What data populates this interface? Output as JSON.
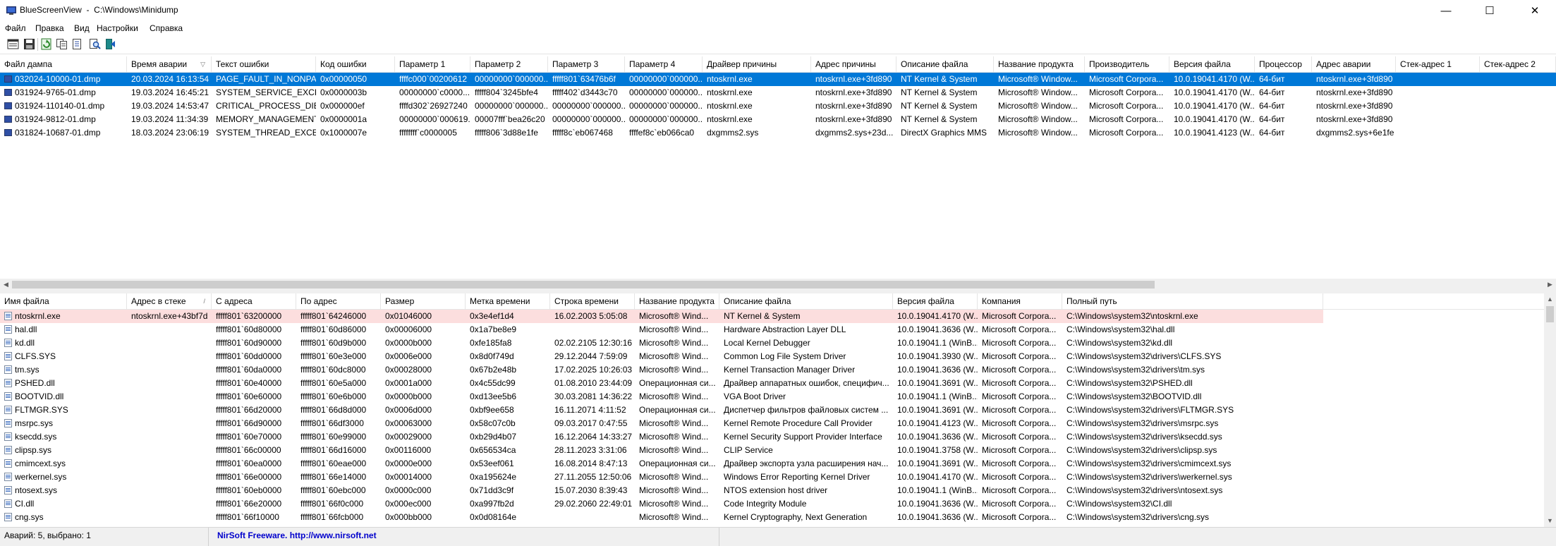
{
  "window": {
    "title": "BlueScreenView  -  C:\\Windows\\Minidump",
    "controls": {
      "minimize": "—",
      "maximize": "☐",
      "close": "✕"
    }
  },
  "menu": [
    "Файл",
    "Правка",
    "Вид",
    "Настройки",
    "Справка"
  ],
  "toolbar": {
    "buttons": [
      "properties-icon",
      "save-icon",
      "refresh-icon",
      "copy-icon",
      "html-report-icon",
      "find-icon",
      "exit-icon"
    ]
  },
  "colors": {
    "selection": "#0078d7",
    "highlight_row": "#fcdede",
    "link": "#0000cc"
  },
  "crash_list": {
    "columns": [
      "Файл дампа",
      "Время аварии",
      "Текст ошибки",
      "Код ошибки",
      "Параметр 1",
      "Параметр 2",
      "Параметр 3",
      "Параметр 4",
      "Драйвер причины",
      "Адрес причины",
      "Описание файла",
      "Название продукта",
      "Производитель",
      "Версия файла",
      "Процессор",
      "Адрес аварии",
      "Стек-адрес 1",
      "Стек-адрес 2"
    ],
    "sort_indicator": "▽",
    "rows": [
      [
        "032024-10000-01.dmp",
        "20.03.2024 16:13:54",
        "PAGE_FAULT_IN_NONPA...",
        "0x00000050",
        "ffffc000`00200612",
        "00000000`000000...",
        "fffff801`63476b6f",
        "00000000`000000...",
        "ntoskrnl.exe",
        "ntoskrnl.exe+3fd890",
        "NT Kernel & System",
        "Microsoft® Window...",
        "Microsoft Corpora...",
        "10.0.19041.4170 (W...",
        "64-бит",
        "ntoskrnl.exe+3fd890",
        "",
        ""
      ],
      [
        "031924-9765-01.dmp",
        "19.03.2024 16:45:21",
        "SYSTEM_SERVICE_EXCEP...",
        "0x0000003b",
        "00000000`c0000...",
        "fffff804`3245bfe4",
        "fffff402`d3443c70",
        "00000000`000000...",
        "ntoskrnl.exe",
        "ntoskrnl.exe+3fd890",
        "NT Kernel & System",
        "Microsoft® Window...",
        "Microsoft Corpora...",
        "10.0.19041.4170 (W...",
        "64-бит",
        "ntoskrnl.exe+3fd890",
        "",
        ""
      ],
      [
        "031924-110140-01.dmp",
        "19.03.2024 14:53:47",
        "CRITICAL_PROCESS_DIED",
        "0x000000ef",
        "ffffd302`26927240",
        "00000000`000000...",
        "00000000`000000...",
        "00000000`000000...",
        "ntoskrnl.exe",
        "ntoskrnl.exe+3fd890",
        "NT Kernel & System",
        "Microsoft® Window...",
        "Microsoft Corpora...",
        "10.0.19041.4170 (W...",
        "64-бит",
        "ntoskrnl.exe+3fd890",
        "",
        ""
      ],
      [
        "031924-9812-01.dmp",
        "19.03.2024 11:34:39",
        "MEMORY_MANAGEMENT",
        "0x0000001a",
        "00000000`000619...",
        "00007fff`bea26c20",
        "00000000`000000...",
        "00000000`000000...",
        "ntoskrnl.exe",
        "ntoskrnl.exe+3fd890",
        "NT Kernel & System",
        "Microsoft® Window...",
        "Microsoft Corpora...",
        "10.0.19041.4170 (W...",
        "64-бит",
        "ntoskrnl.exe+3fd890",
        "",
        ""
      ],
      [
        "031824-10687-01.dmp",
        "18.03.2024 23:06:19",
        "SYSTEM_THREAD_EXCE...",
        "0x1000007e",
        "ffffffff`c0000005",
        "fffff806`3d88e1fe",
        "fffff8c`eb067468",
        "ffffef8c`eb066ca0",
        "dxgmms2.sys",
        "dxgmms2.sys+23d...",
        "DirectX Graphics MMS",
        "Microsoft® Window...",
        "Microsoft Corpora...",
        "10.0.19041.4123 (W...",
        "64-бит",
        "dxgmms2.sys+6e1fe",
        "",
        ""
      ]
    ]
  },
  "driver_list": {
    "columns": [
      "Имя файла",
      "Адрес в стеке",
      "С адреса",
      "По адрес",
      "Размер",
      "Метка времени",
      "Строка времени",
      "Название продукта",
      "Описание файла",
      "Версия файла",
      "Компания",
      "Полный путь"
    ],
    "sort_indicator": "/",
    "rows": [
      [
        "ntoskrnl.exe",
        "ntoskrnl.exe+43bf7d",
        "fffff801`63200000",
        "fffff801`64246000",
        "0x01046000",
        "0x3e4ef1d4",
        "16.02.2003 5:05:08",
        "Microsoft® Wind...",
        "NT Kernel & System",
        "10.0.19041.4170 (W...",
        "Microsoft Corpora...",
        "C:\\Windows\\system32\\ntoskrnl.exe"
      ],
      [
        "hal.dll",
        "",
        "fffff801`60d80000",
        "fffff801`60d86000",
        "0x00006000",
        "0x1a7be8e9",
        "",
        "Microsoft® Wind...",
        "Hardware Abstraction Layer DLL",
        "10.0.19041.3636 (W...",
        "Microsoft Corpora...",
        "C:\\Windows\\system32\\hal.dll"
      ],
      [
        "kd.dll",
        "",
        "fffff801`60d90000",
        "fffff801`60d9b000",
        "0x0000b000",
        "0xfe185fa8",
        "02.02.2105 12:30:16",
        "Microsoft® Wind...",
        "Local Kernel Debugger",
        "10.0.19041.1 (WinB...",
        "Microsoft Corpora...",
        "C:\\Windows\\system32\\kd.dll"
      ],
      [
        "CLFS.SYS",
        "",
        "fffff801`60dd0000",
        "fffff801`60e3e000",
        "0x0006e000",
        "0x8d0f749d",
        "29.12.2044 7:59:09",
        "Microsoft® Wind...",
        "Common Log File System Driver",
        "10.0.19041.3930 (W...",
        "Microsoft Corpora...",
        "C:\\Windows\\system32\\drivers\\CLFS.SYS"
      ],
      [
        "tm.sys",
        "",
        "fffff801`60da0000",
        "fffff801`60dc8000",
        "0x00028000",
        "0x67b2e48b",
        "17.02.2025 10:26:03",
        "Microsoft® Wind...",
        "Kernel Transaction Manager Driver",
        "10.0.19041.3636 (W...",
        "Microsoft Corpora...",
        "C:\\Windows\\system32\\drivers\\tm.sys"
      ],
      [
        "PSHED.dll",
        "",
        "fffff801`60e40000",
        "fffff801`60e5a000",
        "0x0001a000",
        "0x4c55dc99",
        "01.08.2010 23:44:09",
        "Операционная си...",
        "Драйвер аппаратных ошибок, специфич...",
        "10.0.19041.3691 (W...",
        "Microsoft Corpora...",
        "C:\\Windows\\system32\\PSHED.dll"
      ],
      [
        "BOOTVID.dll",
        "",
        "fffff801`60e60000",
        "fffff801`60e6b000",
        "0x0000b000",
        "0xd13ee5b6",
        "30.03.2081 14:36:22",
        "Microsoft® Wind...",
        "VGA Boot Driver",
        "10.0.19041.1 (WinB...",
        "Microsoft Corpora...",
        "C:\\Windows\\system32\\BOOTVID.dll"
      ],
      [
        "FLTMGR.SYS",
        "",
        "fffff801`66d20000",
        "fffff801`66d8d000",
        "0x0006d000",
        "0xbf9ee658",
        "16.11.2071 4:11:52",
        "Операционная си...",
        "Диспетчер фильтров файловых систем ...",
        "10.0.19041.3691 (W...",
        "Microsoft Corpora...",
        "C:\\Windows\\system32\\drivers\\FLTMGR.SYS"
      ],
      [
        "msrpc.sys",
        "",
        "fffff801`66d90000",
        "fffff801`66df3000",
        "0x00063000",
        "0x58c07c0b",
        "09.03.2017 0:47:55",
        "Microsoft® Wind...",
        "Kernel Remote Procedure Call Provider",
        "10.0.19041.4123 (W...",
        "Microsoft Corpora...",
        "C:\\Windows\\system32\\drivers\\msrpc.sys"
      ],
      [
        "ksecdd.sys",
        "",
        "fffff801`60e70000",
        "fffff801`60e99000",
        "0x00029000",
        "0xb29d4b07",
        "16.12.2064 14:33:27",
        "Microsoft® Wind...",
        "Kernel Security Support Provider Interface",
        "10.0.19041.3636 (W...",
        "Microsoft Corpora...",
        "C:\\Windows\\system32\\drivers\\ksecdd.sys"
      ],
      [
        "clipsp.sys",
        "",
        "fffff801`66c00000",
        "fffff801`66d16000",
        "0x00116000",
        "0x656534ca",
        "28.11.2023 3:31:06",
        "Microsoft® Wind...",
        "CLIP Service",
        "10.0.19041.3758 (W...",
        "Microsoft Corpora...",
        "C:\\Windows\\system32\\drivers\\clipsp.sys"
      ],
      [
        "cmimcext.sys",
        "",
        "fffff801`60ea0000",
        "fffff801`60eae000",
        "0x0000e000",
        "0x53eef061",
        "16.08.2014 8:47:13",
        "Операционная си...",
        "Драйвер экспорта узла расширения нач...",
        "10.0.19041.3691 (W...",
        "Microsoft Corpora...",
        "C:\\Windows\\system32\\drivers\\cmimcext.sys"
      ],
      [
        "werkernel.sys",
        "",
        "fffff801`66e00000",
        "fffff801`66e14000",
        "0x00014000",
        "0xa195624e",
        "27.11.2055 12:50:06",
        "Microsoft® Wind...",
        "Windows Error Reporting Kernel Driver",
        "10.0.19041.4170 (W...",
        "Microsoft Corpora...",
        "C:\\Windows\\system32\\drivers\\werkernel.sys"
      ],
      [
        "ntosext.sys",
        "",
        "fffff801`60eb0000",
        "fffff801`60ebc000",
        "0x0000c000",
        "0x71dd3c9f",
        "15.07.2030 8:39:43",
        "Microsoft® Wind...",
        "NTOS extension host driver",
        "10.0.19041.1 (WinB...",
        "Microsoft Corpora...",
        "C:\\Windows\\system32\\drivers\\ntosext.sys"
      ],
      [
        "CI.dll",
        "",
        "fffff801`66e20000",
        "fffff801`66f0c000",
        "0x000ec000",
        "0xa997fb2d",
        "29.02.2060 22:49:01",
        "Microsoft® Wind...",
        "Code Integrity Module",
        "10.0.19041.3636 (W...",
        "Microsoft Corpora...",
        "C:\\Windows\\system32\\CI.dll"
      ],
      [
        "cng.sys",
        "",
        "fffff801`66f10000",
        "fffff801`66fcb000",
        "0x000bb000",
        "0x0d08164e",
        "",
        "Microsoft® Wind...",
        "Kernel Cryptography, Next Generation",
        "10.0.19041.3636 (W...",
        "Microsoft Corpora...",
        "C:\\Windows\\system32\\drivers\\cng.sys"
      ]
    ]
  },
  "status": {
    "counts": "Аварий: 5, выбрано: 1",
    "credit": "NirSoft Freeware.  http://www.nirsoft.net"
  }
}
